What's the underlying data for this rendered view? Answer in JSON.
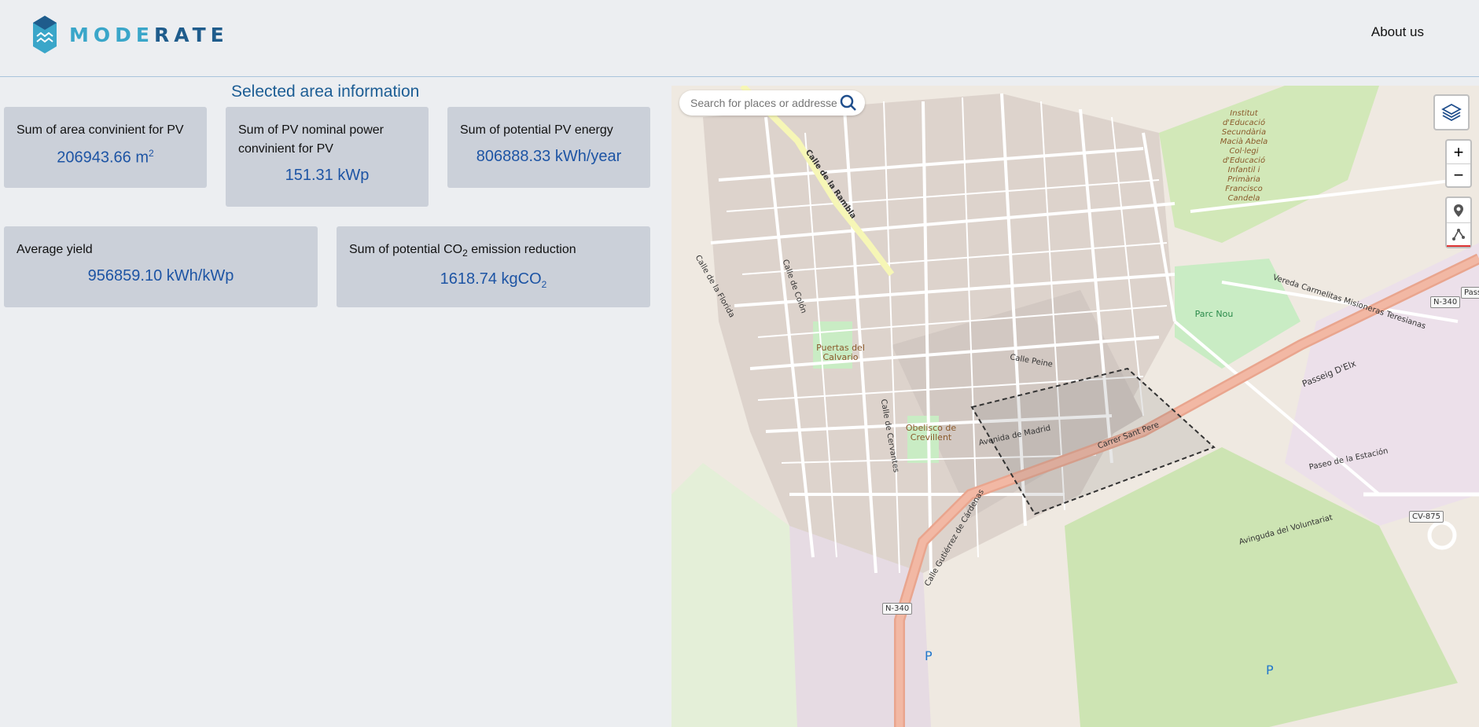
{
  "header": {
    "logo_text_light": "MODE",
    "logo_text_dark": "RATE",
    "about_label": "About us"
  },
  "main": {
    "title": "Selected area information",
    "cards": {
      "area": {
        "label": "Sum of area convinient for PV",
        "value": "206943.66 m",
        "unit_sup": "2"
      },
      "power": {
        "label": "Sum of PV nominal power convinient for PV",
        "value": "151.31 kWp"
      },
      "energy": {
        "label": "Sum of potential PV energy",
        "value": "806888.33 kWh/year"
      },
      "yield": {
        "label": "Average yield",
        "value": "956859.10 kWh/kWp"
      },
      "co2": {
        "label_pre": "Sum of potential CO",
        "label_sub": "2",
        "label_post": " emission reduction",
        "value": "1618.74 kgCO",
        "value_sub": "2"
      }
    }
  },
  "map": {
    "search_placeholder": "Search for places or addresses",
    "zoom_in": "+",
    "zoom_out": "−",
    "labels": {
      "rambla": "Calle de la Rambla",
      "elx": "Passeig D'Elx",
      "gutierrez": "Calle Gutiérrez de Cárdenas",
      "estacion": "Paseo de la Estación",
      "madrid": "Avenida de Madrid",
      "sant_pere": "Carrer Sant Pere",
      "voluntariat": "Avinguda del Voluntariat",
      "colon": "Calle de Colón",
      "florida": "Calle de la Florida",
      "vereda": "Vereda Carmelitas Misioneras Teresianas",
      "peine": "Calle Peine",
      "cervantes": "Calle de Cervantes"
    },
    "pois": {
      "puertas": "Puertas del Calvario",
      "obelisco": "Obelisco de Crevillent",
      "porc_nou": "Parc Nou",
      "instituto": "Institut d'Educació Secundària Macià Abela Col·legi d'Educació Infantil i Primària Francisco Candela"
    },
    "shields": {
      "n340a": "N-340",
      "n340b": "N-340",
      "cv875": "CV-875",
      "pass": "Pass"
    },
    "parking": "P"
  }
}
